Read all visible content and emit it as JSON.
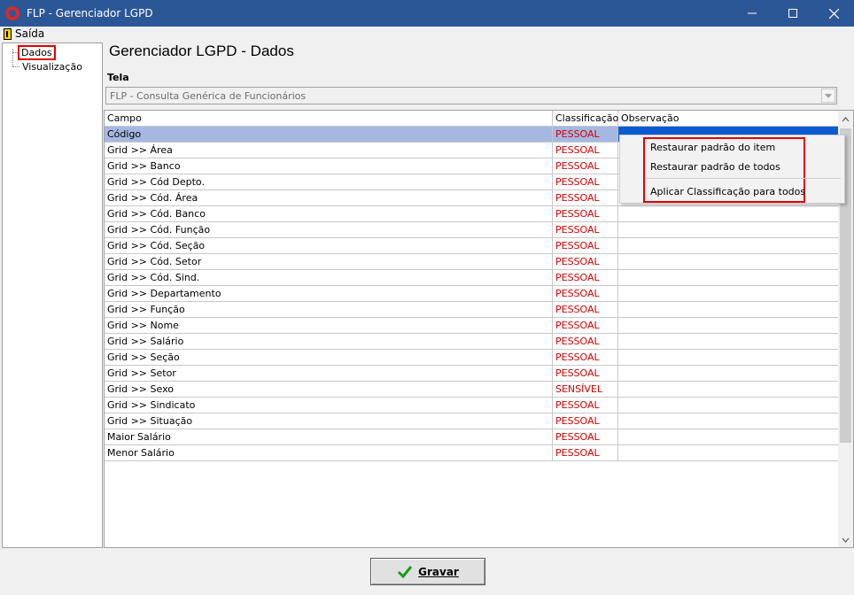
{
  "window": {
    "title": "FLP - Gerenciador LGPD"
  },
  "menu": {
    "exit_label": "Saída"
  },
  "tree": {
    "items": [
      {
        "label": "Dados",
        "selected": true
      },
      {
        "label": "Visualização",
        "selected": false
      }
    ]
  },
  "main": {
    "title": "Gerenciador LGPD - Dados",
    "tela_label": "Tela",
    "tela_value": "FLP - Consulta Genérica de Funcionários"
  },
  "grid": {
    "headers": [
      "Campo",
      "Classificação",
      "Observação"
    ],
    "rows": [
      {
        "campo": "Código",
        "classificacao": "PESSOAL",
        "observacao": ""
      },
      {
        "campo": "Grid >> Área",
        "classificacao": "PESSOAL",
        "observacao": ""
      },
      {
        "campo": "Grid >> Banco",
        "classificacao": "PESSOAL",
        "observacao": ""
      },
      {
        "campo": "Grid >> Cód Depto.",
        "classificacao": "PESSOAL",
        "observacao": ""
      },
      {
        "campo": "Grid >> Cód. Área",
        "classificacao": "PESSOAL",
        "observacao": ""
      },
      {
        "campo": "Grid >> Cód. Banco",
        "classificacao": "PESSOAL",
        "observacao": ""
      },
      {
        "campo": "Grid >> Cód. Função",
        "classificacao": "PESSOAL",
        "observacao": ""
      },
      {
        "campo": "Grid >> Cód. Seção",
        "classificacao": "PESSOAL",
        "observacao": ""
      },
      {
        "campo": "Grid >> Cód. Setor",
        "classificacao": "PESSOAL",
        "observacao": ""
      },
      {
        "campo": "Grid >> Cód. Sind.",
        "classificacao": "PESSOAL",
        "observacao": ""
      },
      {
        "campo": "Grid >> Departamento",
        "classificacao": "PESSOAL",
        "observacao": ""
      },
      {
        "campo": "Grid >> Função",
        "classificacao": "PESSOAL",
        "observacao": ""
      },
      {
        "campo": "Grid >> Nome",
        "classificacao": "PESSOAL",
        "observacao": ""
      },
      {
        "campo": "Grid >> Salário",
        "classificacao": "PESSOAL",
        "observacao": ""
      },
      {
        "campo": "Grid >> Seção",
        "classificacao": "PESSOAL",
        "observacao": ""
      },
      {
        "campo": "Grid >> Setor",
        "classificacao": "PESSOAL",
        "observacao": ""
      },
      {
        "campo": "Grid >> Sexo",
        "classificacao": "SENSÍVEL",
        "observacao": ""
      },
      {
        "campo": "Grid >> Sindicato",
        "classificacao": "PESSOAL",
        "observacao": ""
      },
      {
        "campo": "Grid >> Situação",
        "classificacao": "PESSOAL",
        "observacao": ""
      },
      {
        "campo": "Maior Salário",
        "classificacao": "PESSOAL",
        "observacao": ""
      },
      {
        "campo": "Menor Salário",
        "classificacao": "PESSOAL",
        "observacao": ""
      }
    ],
    "selected_row": 0
  },
  "context_menu": {
    "items": [
      "Restaurar padrão do item",
      "Restaurar padrão de todos",
      "Aplicar Classificação para todos"
    ]
  },
  "footer": {
    "save_label": "Gravar"
  },
  "colors": {
    "title_bar": "#2b5797",
    "classification_text": "#d40000",
    "selection_row": "#a6b8e2",
    "selection_cell": "#0a5bd1",
    "highlight": "#e00000"
  }
}
